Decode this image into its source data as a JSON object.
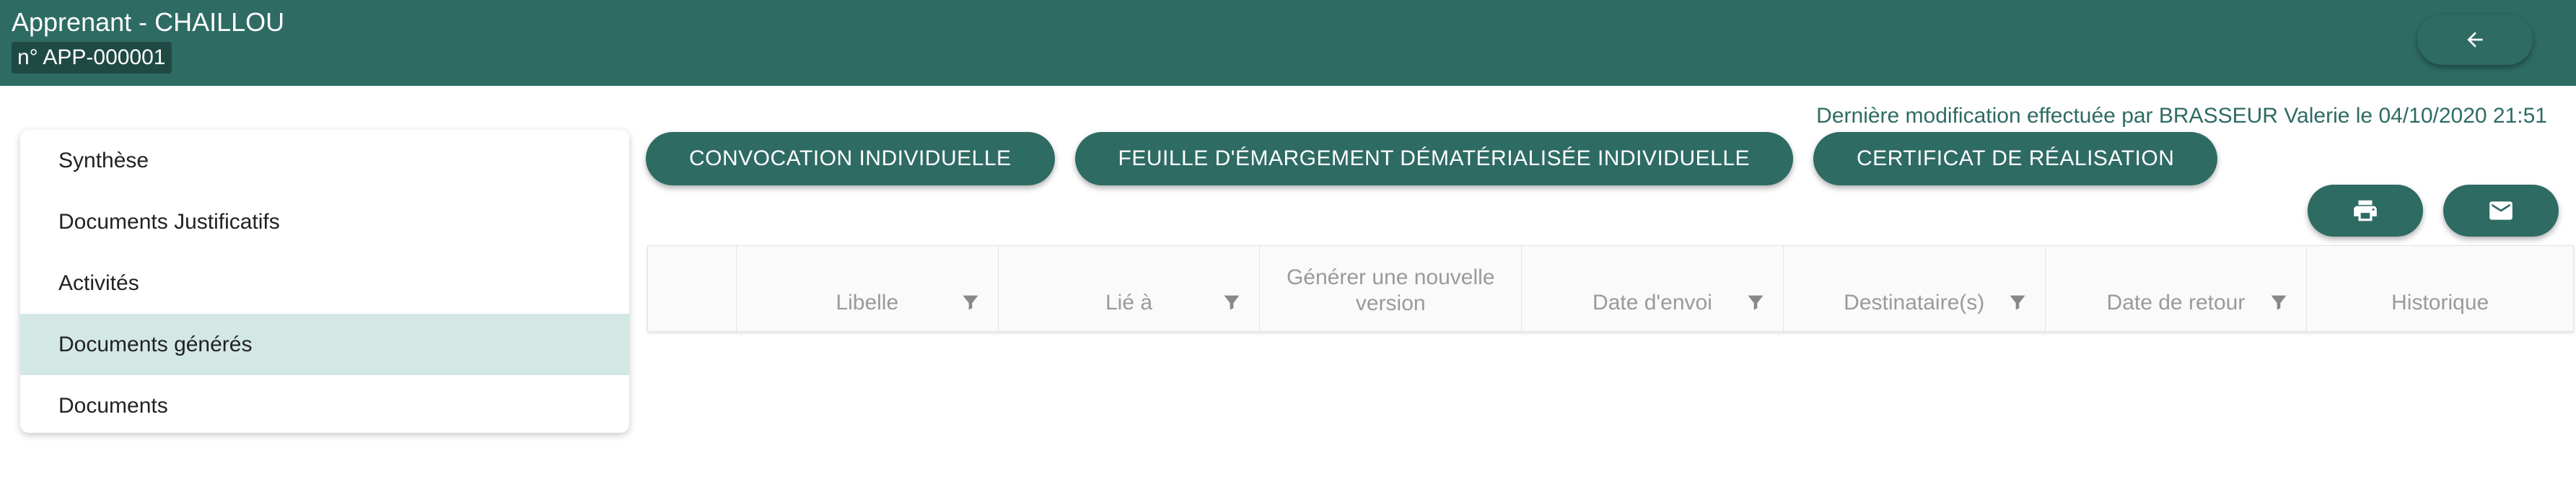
{
  "header": {
    "title": "Apprenant - CHAILLOU",
    "badge": "n° APP-000001"
  },
  "modification": {
    "text": "Dernière modification effectuée par BRASSEUR Valerie le 04/10/2020 21:51"
  },
  "sidebar": {
    "items": [
      {
        "label": "Synthèse",
        "active": false
      },
      {
        "label": "Documents Justificatifs",
        "active": false
      },
      {
        "label": "Activités",
        "active": false
      },
      {
        "label": "Documents générés",
        "active": true
      },
      {
        "label": "Documents",
        "active": false
      }
    ]
  },
  "actions": {
    "convocation": "CONVOCATION INDIVIDUELLE",
    "feuille": "FEUILLE D'ÉMARGEMENT DÉMATÉRIALISÉE INDIVIDUELLE",
    "certificat": "CERTIFICAT DE RÉALISATION"
  },
  "icons": {
    "back": "arrow-left-icon",
    "print": "print-icon",
    "mail": "mail-icon",
    "filter": "filter-icon"
  },
  "table": {
    "columns": {
      "libelle": "Libelle",
      "lie": "Lié à",
      "generer_1": "Générer une nouvelle",
      "generer_2": "version",
      "date_envoi": "Date d'envoi",
      "destinataires": "Destinataire(s)",
      "date_retour": "Date de retour",
      "historique": "Historique"
    }
  },
  "colors": {
    "primary": "#2e6b63",
    "active_bg": "#d3e8e4"
  }
}
